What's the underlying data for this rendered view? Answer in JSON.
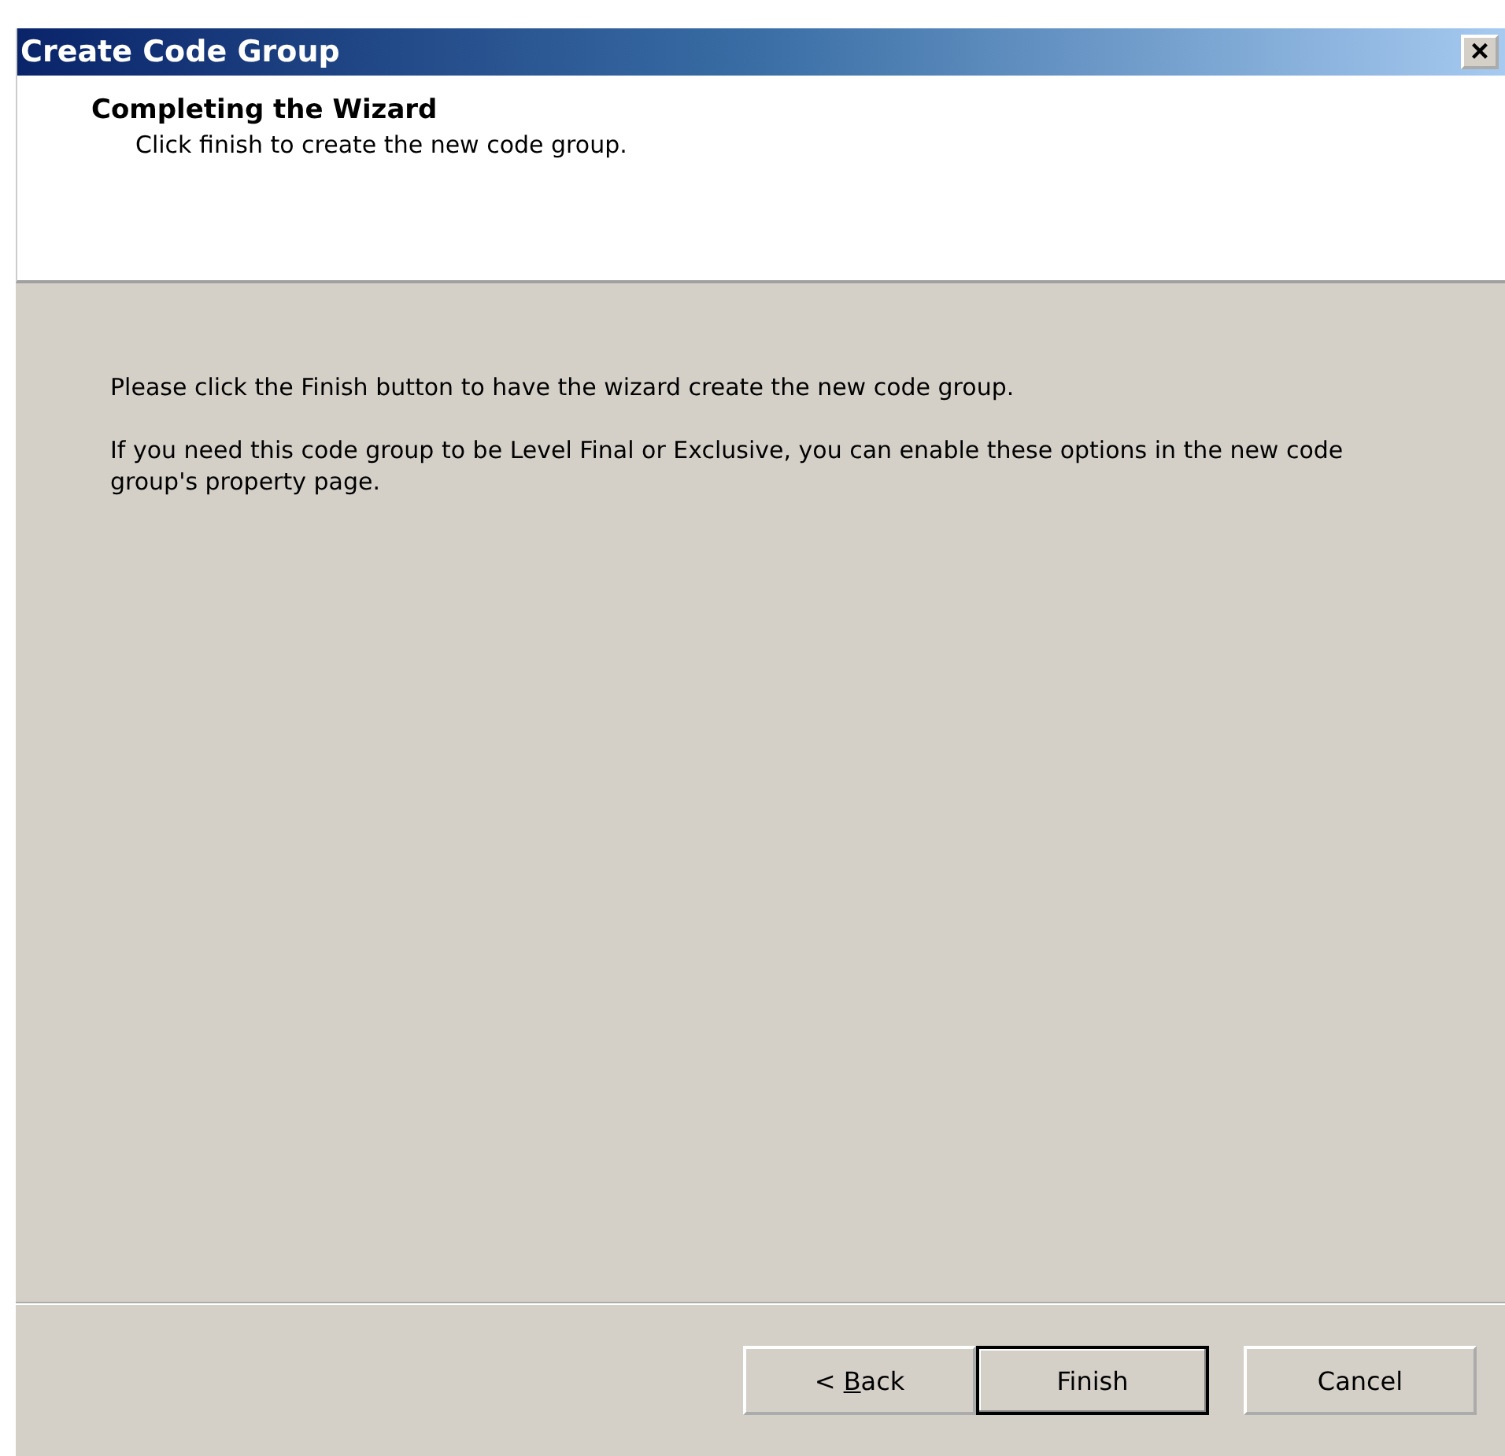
{
  "window": {
    "title": "Create Code Group",
    "close": "×"
  },
  "header": {
    "title": "Completing the Wizard",
    "subtitle": "Click finish to create the new code group."
  },
  "body": [
    "Please click the Finish button to have the wizard create the new code group.",
    "If you need this code group to be Level Final or Exclusive, you can enable these options in the new code group's property page."
  ],
  "buttons": [
    {
      "before": "< ",
      "key": "B",
      "after": "ack",
      "default": false
    },
    {
      "before": "Finish",
      "default": true
    },
    {
      "before": "Cancel",
      "default": false
    }
  ]
}
